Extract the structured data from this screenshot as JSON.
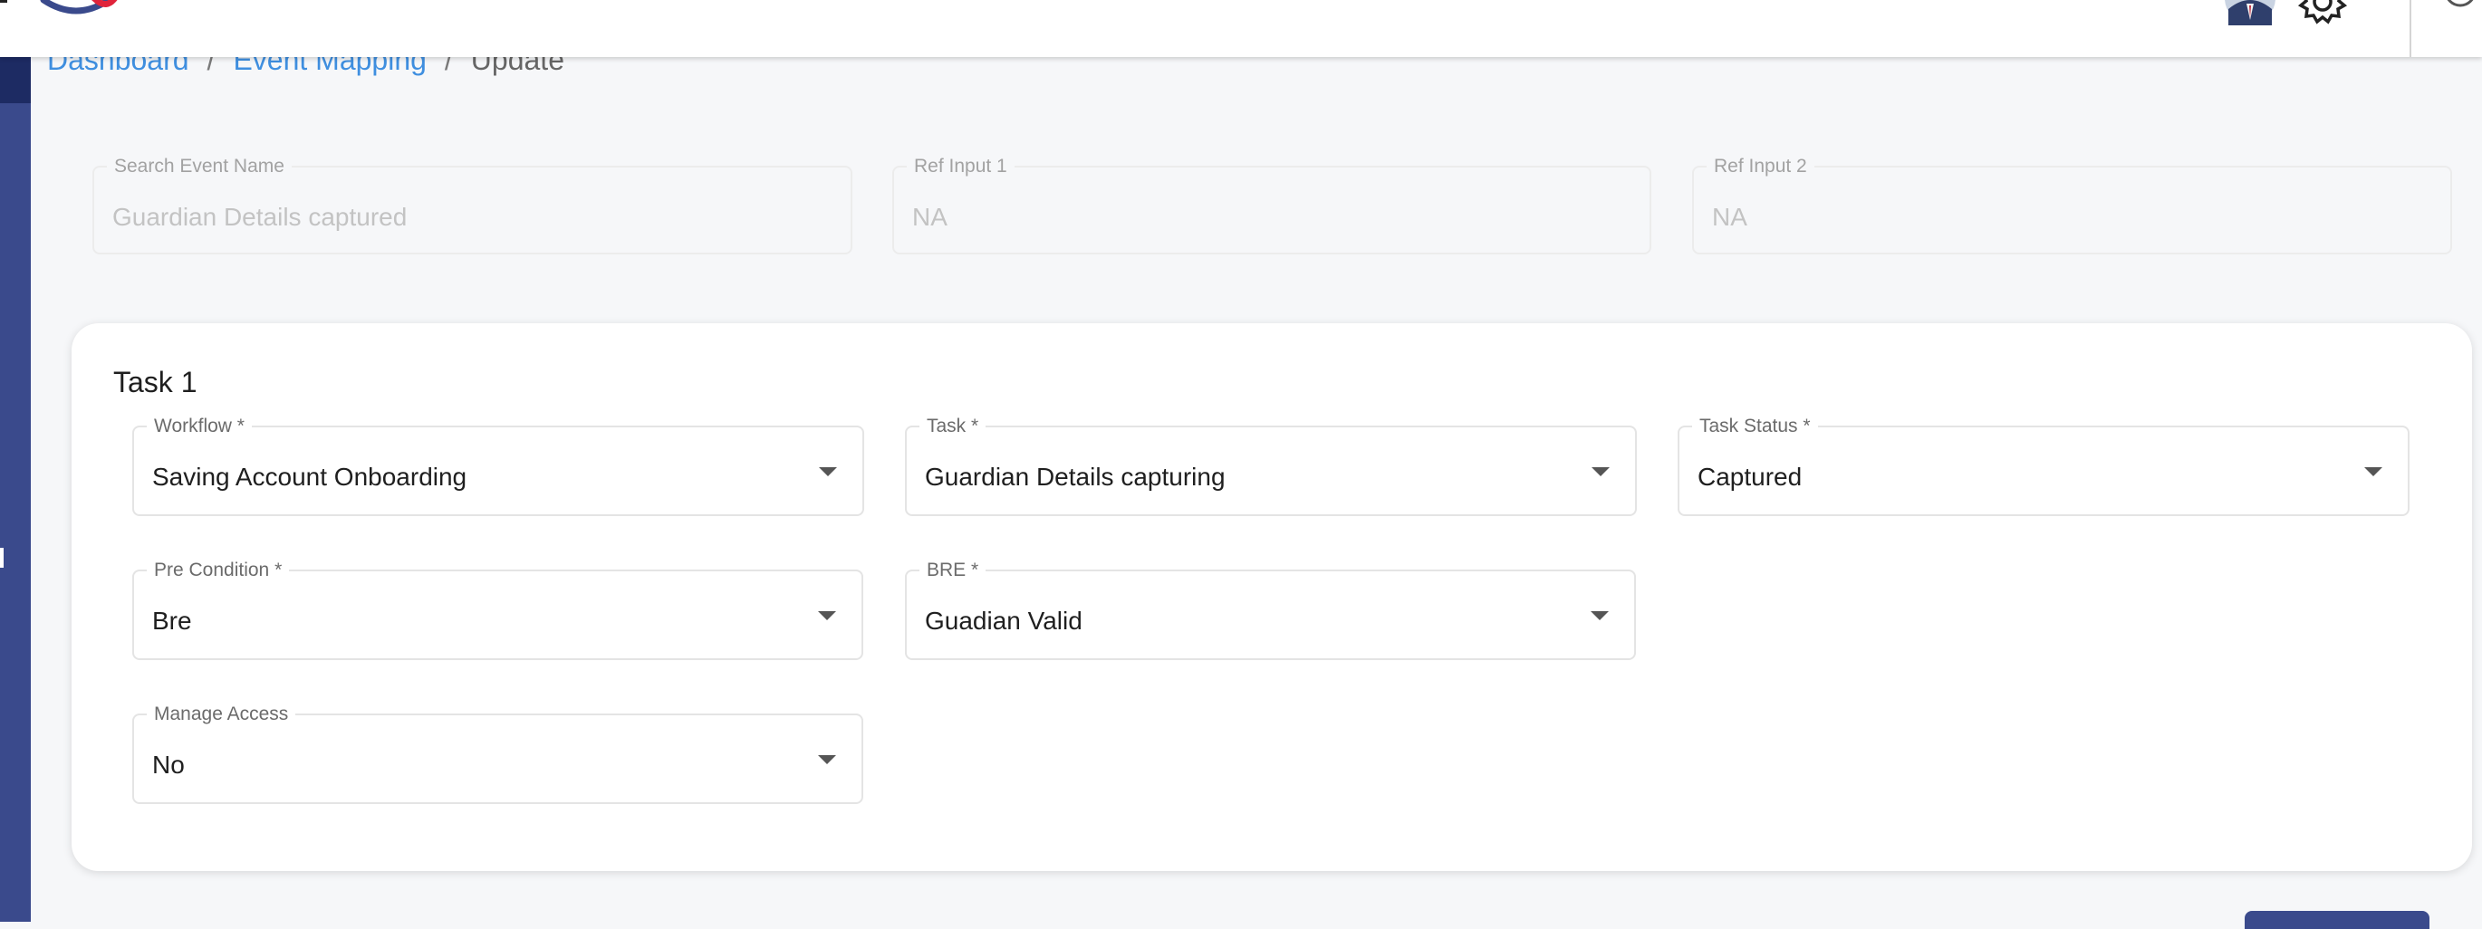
{
  "header": {
    "logo_icon": "brand-logo-icon",
    "avatar_icon": "user-avatar-icon",
    "settings_icon": "gear-icon",
    "power_icon": "power-icon"
  },
  "breadcrumb": {
    "items": [
      "Dashboard",
      "Event Mapping"
    ],
    "separator": "/",
    "current": "Update"
  },
  "event": {
    "search_event_name": {
      "label": "Search Event Name",
      "value": "Guardian Details captured"
    },
    "ref_input_1": {
      "label": "Ref Input 1",
      "value": "NA"
    },
    "ref_input_2": {
      "label": "Ref Input 2",
      "value": "NA"
    }
  },
  "task_card": {
    "title": "Task 1",
    "workflow": {
      "label": "Workflow *",
      "value": "Saving Account Onboarding"
    },
    "task": {
      "label": "Task *",
      "value": "Guardian Details capturing"
    },
    "task_status": {
      "label": "Task Status *",
      "value": "Captured"
    },
    "pre_condition": {
      "label": "Pre Condition *",
      "value": "Bre"
    },
    "bre": {
      "label": "BRE *",
      "value": "Guadian Valid"
    },
    "manage_access": {
      "label": "Manage Access",
      "value": "No"
    }
  },
  "colors": {
    "primary": "#3a4a8c",
    "link": "#3f8fe0",
    "background": "#f6f7f9"
  }
}
